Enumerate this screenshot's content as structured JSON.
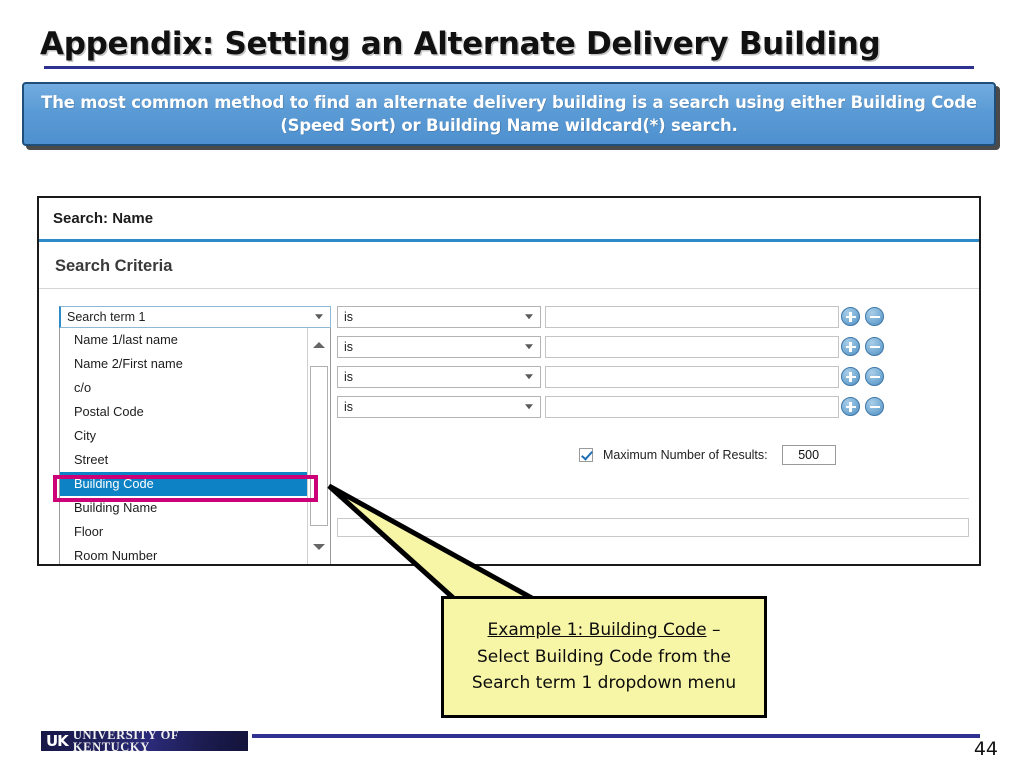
{
  "slide": {
    "title": "Appendix: Setting an Alternate Delivery Building",
    "page_number": "44",
    "accent_color": "#2E3192",
    "banner_color": "#5B9BD5",
    "highlight_ring_color": "#CC0077",
    "selected_row_color": "#0D82C4",
    "callout_color": "#F7F5A6"
  },
  "banner": {
    "text": "The most common method to find an alternate delivery building is a search using either Building Code (Speed Sort) or Building Name wildcard(*) search."
  },
  "panel": {
    "search_title": "Search: Name",
    "criteria_title": "Search Criteria",
    "term_select": {
      "value": "Search term 1",
      "options": [
        "Name 1/last name",
        "Name 2/First name",
        "c/o",
        "Postal Code",
        "City",
        "Street",
        "Building Code",
        "Building Name",
        "Floor",
        "Room Number"
      ],
      "selected_option": "Building Code"
    },
    "rows": [
      {
        "operator": "is",
        "value": "",
        "add_label": "+",
        "remove_label": "−"
      },
      {
        "operator": "is",
        "value": "",
        "add_label": "+",
        "remove_label": "−"
      },
      {
        "operator": "is",
        "value": "",
        "add_label": "+",
        "remove_label": "−"
      },
      {
        "operator": "is",
        "value": "",
        "add_label": "+",
        "remove_label": "−"
      }
    ],
    "max_results": {
      "label": "Maximum Number of Results:",
      "value": "500",
      "checked": true
    },
    "bottom_field_value": ""
  },
  "callout": {
    "line1_underlined": "Example 1: Building Code",
    "line1_tail": " –",
    "line2": "Select Building Code from the",
    "line3": "Search term 1 dropdown menu"
  },
  "footer": {
    "logo_mark": "UK",
    "logo_name": "UNIVERSITY OF KENTUCKY"
  }
}
